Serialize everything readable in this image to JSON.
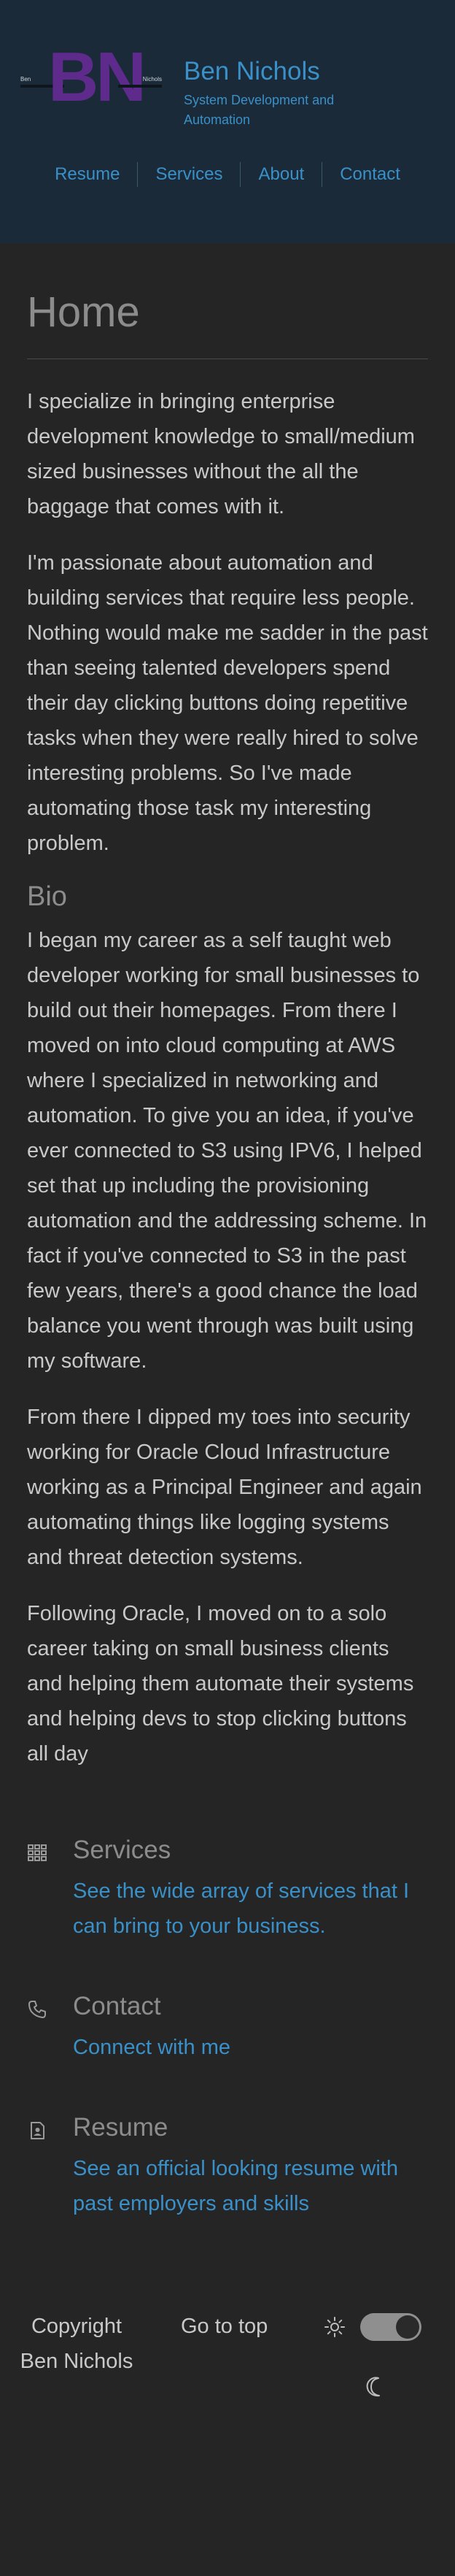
{
  "header": {
    "logo": {
      "monogram": "BN",
      "mini_left": "Ben",
      "mini_right": "Nichols"
    },
    "site_name": "Ben Nichols",
    "tagline": "System Development and Automation",
    "nav": [
      {
        "label": "Resume"
      },
      {
        "label": "Services"
      },
      {
        "label": "About"
      },
      {
        "label": "Contact"
      }
    ]
  },
  "main": {
    "title": "Home",
    "intro": [
      "I specialize in bringing enterprise development knowledge to small/medium sized businesses without the all the baggage that comes with it.",
      "I'm passionate about automation and building services that require less people. Nothing would make me sadder in the past than seeing talented developers spend their day clicking buttons doing repetitive tasks when they were really hired to solve interesting problems. So I've made automating those task my interesting problem."
    ],
    "bio_heading": "Bio",
    "bio": [
      "I began my career as a self taught web developer working for small businesses to build out their homepages. From there I moved on into cloud computing at AWS where I specialized in networking and automation. To give you an idea, if you've ever connected to S3 using IPV6, I helped set that up including the provisioning automation and the addressing scheme. In fact if you've connected to S3 in the past few years, there's a good chance the load balance you went through was built using my software.",
      "From there I dipped my toes into security working for Oracle Cloud Infrastructure working as a Principal Engineer and again automating things like logging systems and threat detection systems.",
      "Following Oracle, I moved on to a solo career taking on small business clients and helping them automate their systems and helping devs to stop clicking buttons all day"
    ],
    "cards": [
      {
        "icon": "services-grid-icon",
        "title": "Services",
        "link": "See the wide array of services that I can bring to your business."
      },
      {
        "icon": "phone-icon",
        "title": "Contact",
        "link": "Connect with me"
      },
      {
        "icon": "resume-badge-icon",
        "title": "Resume",
        "link": "See an official looking resume with past employers and skills"
      }
    ]
  },
  "footer": {
    "copyright": "Copyright Ben Nichols",
    "go_to_top": "Go to top",
    "theme": {
      "sun_icon": "sun-icon",
      "moon_icon": "moon-icon",
      "dark_mode_on": true
    }
  },
  "colors": {
    "background": "#252525",
    "header_background": "#1b2a38",
    "link": "#3a90c8",
    "heading_muted": "#8c8c8c",
    "body_text": "#c9c9c9",
    "logo_purple": "#5e2a8c"
  }
}
